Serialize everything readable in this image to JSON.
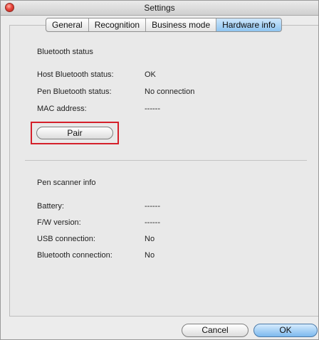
{
  "window": {
    "title": "Settings"
  },
  "tabs": [
    {
      "label": "General",
      "active": false
    },
    {
      "label": "Recognition",
      "active": false
    },
    {
      "label": "Business mode",
      "active": false
    },
    {
      "label": "Hardware info",
      "active": true
    }
  ],
  "bluetooth": {
    "section_title": "Bluetooth status",
    "rows": [
      {
        "label": "Host Bluetooth status:",
        "value": "OK"
      },
      {
        "label": "Pen Bluetooth status:",
        "value": "No connection"
      },
      {
        "label": "MAC address:",
        "value": "------"
      }
    ],
    "pair_label": "Pair"
  },
  "scanner": {
    "section_title": "Pen scanner info",
    "rows": [
      {
        "label": "Battery:",
        "value": "------"
      },
      {
        "label": "F/W version:",
        "value": "------"
      },
      {
        "label": "USB connection:",
        "value": "No"
      },
      {
        "label": "Bluetooth connection:",
        "value": "No"
      }
    ]
  },
  "footer": {
    "cancel_label": "Cancel",
    "ok_label": "OK"
  },
  "colors": {
    "highlight": "#d5202a",
    "active_tab": "#8ec4f0",
    "close_button": "#e8453b"
  },
  "icons": {
    "close": "close-icon"
  }
}
